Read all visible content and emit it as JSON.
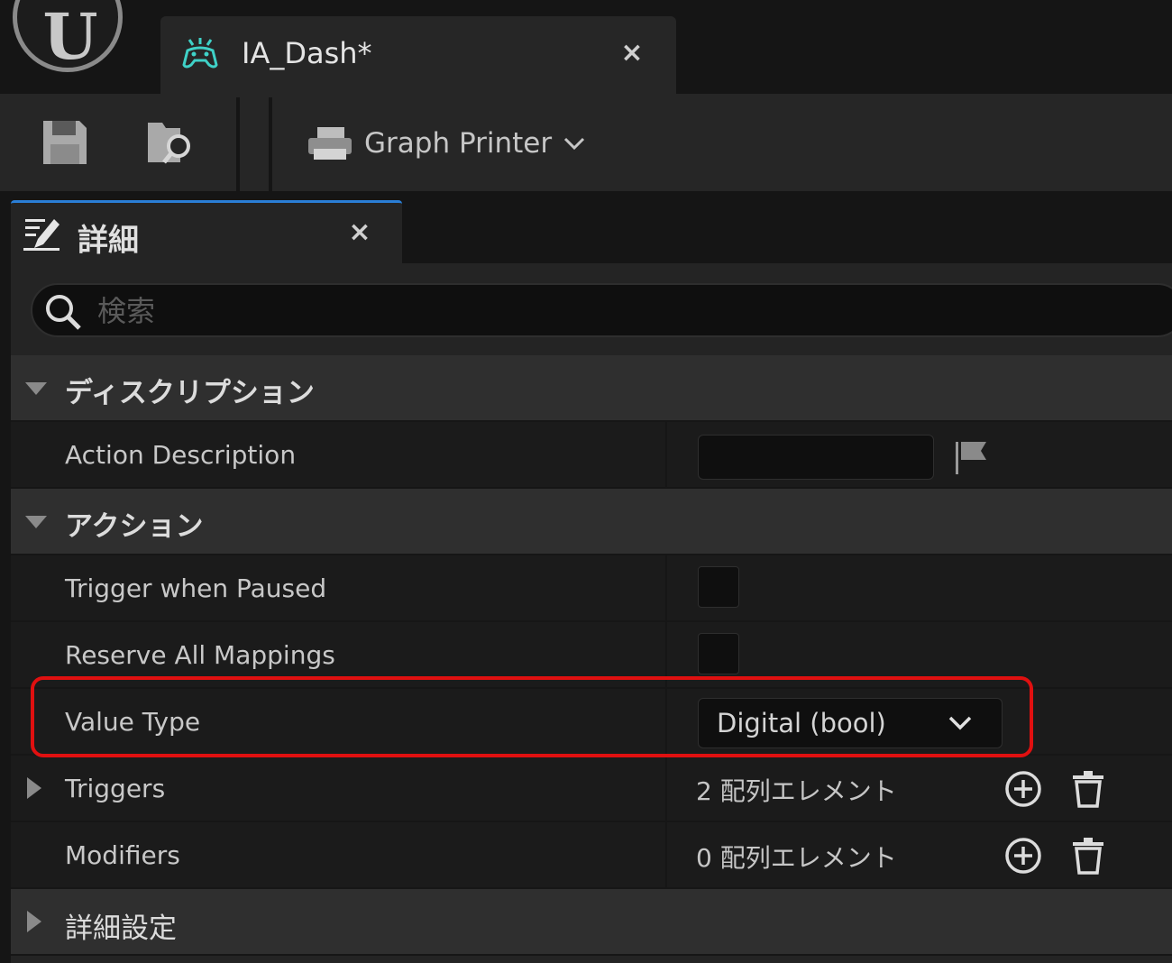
{
  "window": {
    "logo_text": "U",
    "tab_title": "IA_Dash*",
    "tab_close": "×"
  },
  "toolbar": {
    "graph_printer_label": "Graph Printer"
  },
  "details": {
    "tab_title": "詳細",
    "tab_close": "×",
    "search_placeholder": "検索",
    "categories": {
      "description": "ディスクリプション",
      "action": "アクション",
      "advanced": "詳細設定"
    },
    "properties": {
      "action_description": "Action Description",
      "trigger_when_paused": "Trigger when Paused",
      "reserve_all_mappings": "Reserve All Mappings",
      "value_type": "Value Type",
      "value_type_selected": "Digital (bool)",
      "triggers": "Triggers",
      "triggers_count": "2 配列エレメント",
      "modifiers": "Modifiers",
      "modifiers_count": "0 配列エレメント"
    }
  },
  "colors": {
    "accent_tab": "#2a7ed6",
    "highlight": "#e01010",
    "input_asset_icon": "#3fd1c7"
  }
}
